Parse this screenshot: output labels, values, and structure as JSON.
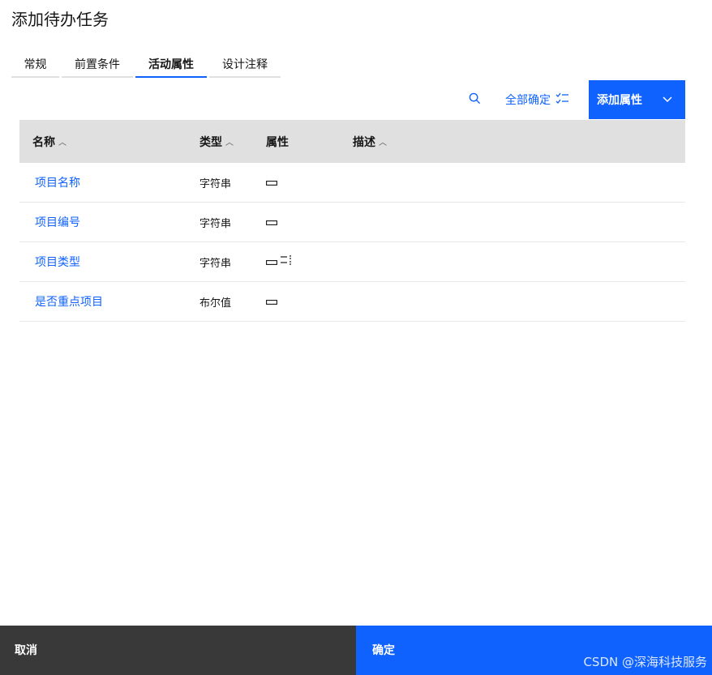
{
  "dialog": {
    "title": "添加待办任务"
  },
  "tabs": [
    {
      "label": "常规",
      "active": false
    },
    {
      "label": "前置条件",
      "active": false
    },
    {
      "label": "活动属性",
      "active": true
    },
    {
      "label": "设计注释",
      "active": false
    }
  ],
  "toolbar": {
    "search_icon": "search-icon",
    "confirm_all_label": "全部确定",
    "confirm_all_icon": "checklist-icon",
    "add_label": "添加属性",
    "add_icon": "chevron-down-icon"
  },
  "table": {
    "headers": {
      "name": "名称",
      "type": "类型",
      "attr": "属性",
      "desc": "描述"
    },
    "sort_icon": "sort-ascending-icon",
    "rows": [
      {
        "name": "项目名称",
        "type": "字符串",
        "attr_icons": [
          "field-box-icon"
        ],
        "desc": ""
      },
      {
        "name": "项目编号",
        "type": "字符串",
        "attr_icons": [
          "field-box-icon"
        ],
        "desc": ""
      },
      {
        "name": "项目类型",
        "type": "字符串",
        "attr_icons": [
          "field-box-icon",
          "list-icon"
        ],
        "desc": ""
      },
      {
        "name": "是否重点项目",
        "type": "布尔值",
        "attr_icons": [
          "field-box-icon"
        ],
        "desc": ""
      }
    ]
  },
  "footer": {
    "cancel_label": "取消",
    "ok_label": "确定",
    "watermark": "CSDN @深海科技服务"
  },
  "colors": {
    "primary": "#0f62fe",
    "secondary": "#393939",
    "header_bg": "#e0e0e0"
  }
}
